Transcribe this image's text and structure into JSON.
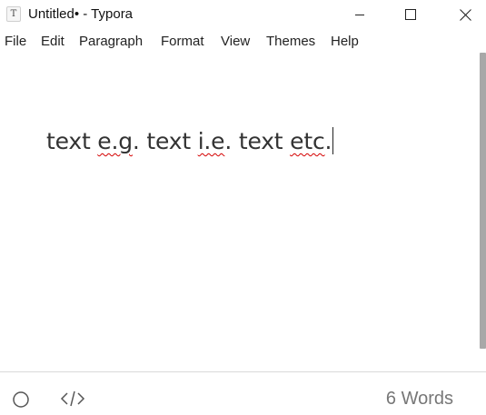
{
  "app": {
    "title": "Untitled• - Typora",
    "icon_letter": "T",
    "icon": "typora-app-icon"
  },
  "window_controls": {
    "minimize_icon": "minimize-icon",
    "maximize_icon": "maximize-icon",
    "close_icon": "close-icon"
  },
  "menu": {
    "items": [
      "File",
      "Edit",
      "Paragraph",
      "Format",
      "View",
      "Themes",
      "Help"
    ]
  },
  "editor": {
    "segments": [
      {
        "text": "text ",
        "misspelled": false
      },
      {
        "text": "e.g",
        "misspelled": true
      },
      {
        "text": ". text ",
        "misspelled": false
      },
      {
        "text": "i.e",
        "misspelled": true
      },
      {
        "text": ". text ",
        "misspelled": false
      },
      {
        "text": "etc",
        "misspelled": true
      },
      {
        "text": ".",
        "misspelled": false
      }
    ],
    "spellcheck_color": "#d40000"
  },
  "footer": {
    "sidebar_toggle_icon": "circle-icon",
    "source_toggle_icon": "code-icon",
    "word_count": "6 Words"
  }
}
